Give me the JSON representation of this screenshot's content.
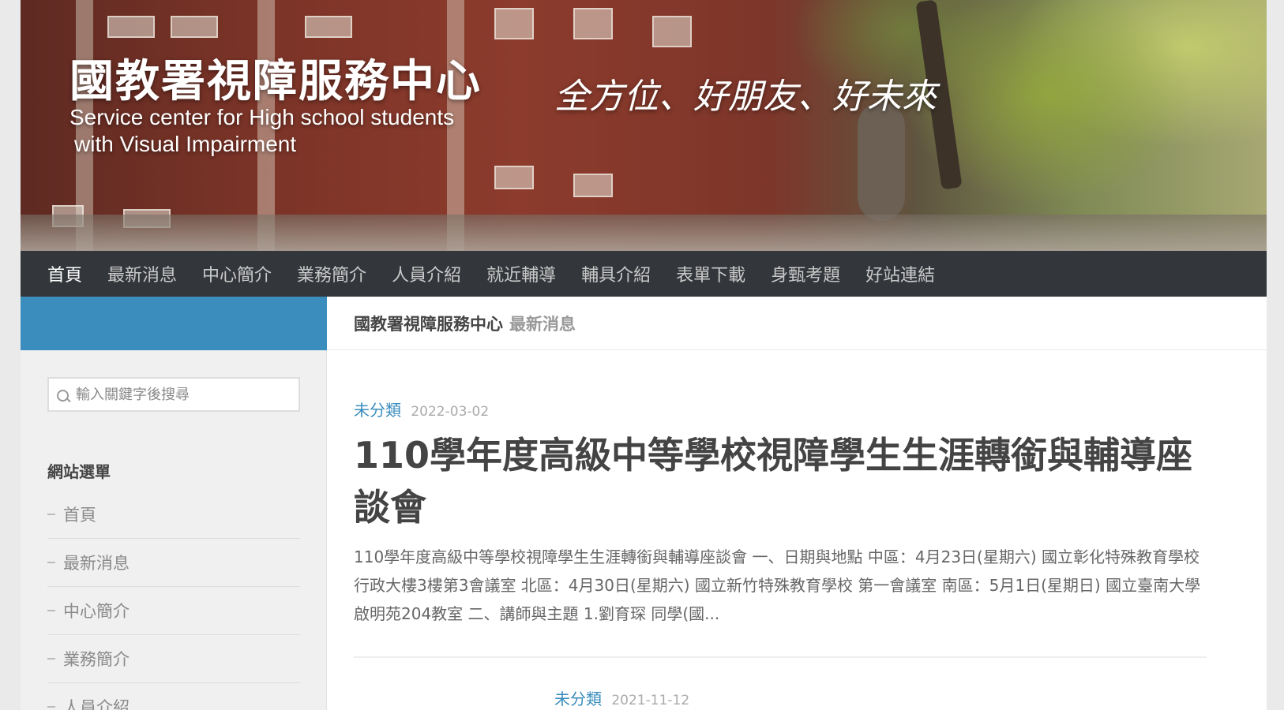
{
  "header": {
    "title": "國教署視障服務中心",
    "subtitle_line1": "Service center for High school students",
    "subtitle_line2": "with Visual Impairment",
    "tagline": "全方位、好朋友、好未來"
  },
  "nav": {
    "items": [
      {
        "label": "首頁",
        "active": true
      },
      {
        "label": "最新消息"
      },
      {
        "label": "中心簡介"
      },
      {
        "label": "業務簡介"
      },
      {
        "label": "人員介紹"
      },
      {
        "label": "就近輔導"
      },
      {
        "label": "輔具介紹"
      },
      {
        "label": "表單下載"
      },
      {
        "label": "身甄考題"
      },
      {
        "label": "好站連結"
      }
    ]
  },
  "breadcrumb": {
    "site": "國教署視障服務中心",
    "page": "最新消息"
  },
  "sidebar": {
    "search_placeholder": "輸入關鍵字後搜尋",
    "widget_title": "網站選單",
    "menu": [
      "首頁",
      "最新消息",
      "中心簡介",
      "業務簡介",
      "人員介紹"
    ]
  },
  "posts": [
    {
      "category": "未分類",
      "date": "2022-03-02",
      "title": "110學年度高級中等學校視障學生生涯轉銜與輔導座談會",
      "excerpt": "110學年度高級中等學校視障學生生涯轉銜與輔導座談會 一、日期與地點 中區：4月23日(星期六) 國立彰化特殊教育學校 行政大樓3樓第3會議室 北區：4月30日(星期六) 國立新竹特殊教育學校 第一會議室 南區：5月1日(星期日) 國立臺南大學 啟明苑204教室 二、講師與主題 1.劉育琛 同學(國..."
    },
    {
      "category": "未分類",
      "date": "2021-11-12"
    }
  ],
  "colors": {
    "accent": "#3b8dbd",
    "navbar": "#33363b"
  }
}
